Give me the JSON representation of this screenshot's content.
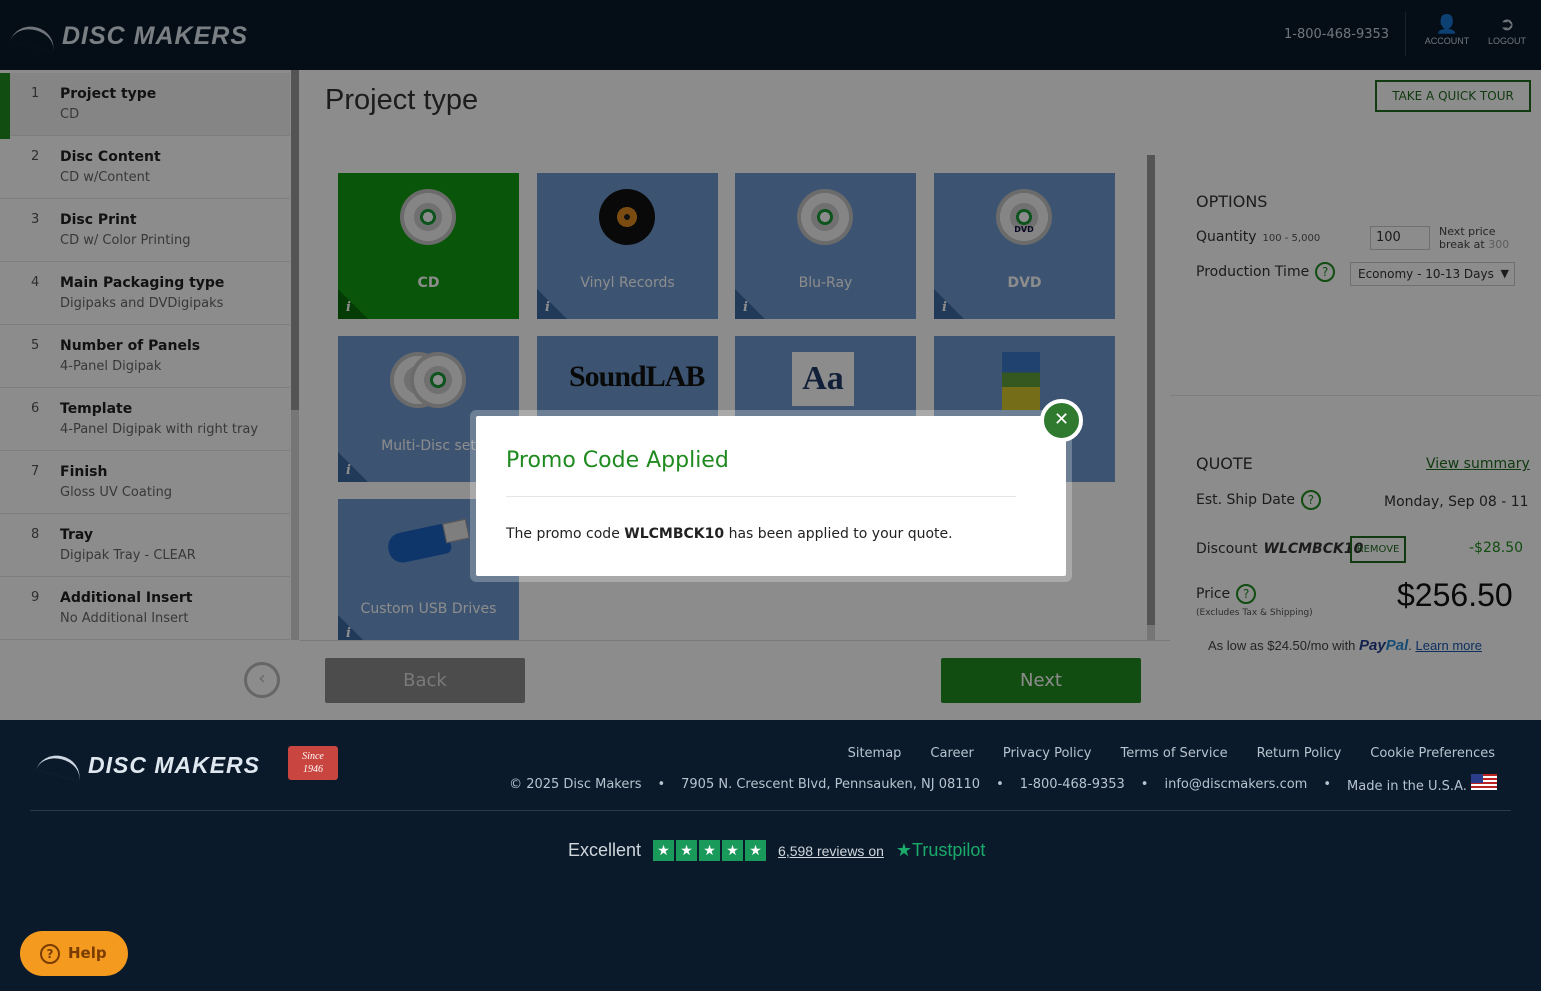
{
  "header": {
    "logo_text": "DISC MAKERS",
    "phone": "1-800-468-9353",
    "account_label": "ACCOUNT",
    "logout_label": "LOGOUT"
  },
  "sidebar": {
    "steps": [
      {
        "num": "1",
        "title": "Project type",
        "value": "CD"
      },
      {
        "num": "2",
        "title": "Disc Content",
        "value": "CD w/Content"
      },
      {
        "num": "3",
        "title": "Disc Print",
        "value": "CD w/ Color Printing"
      },
      {
        "num": "4",
        "title": "Main Packaging type",
        "value": "Digipaks and DVDigipaks"
      },
      {
        "num": "5",
        "title": "Number of Panels",
        "value": "4-Panel Digipak"
      },
      {
        "num": "6",
        "title": "Template",
        "value": "4-Panel Digipak with right tray"
      },
      {
        "num": "7",
        "title": "Finish",
        "value": "Gloss UV Coating"
      },
      {
        "num": "8",
        "title": "Tray",
        "value": "Digipak Tray - CLEAR"
      },
      {
        "num": "9",
        "title": "Additional Insert",
        "value": "No Additional Insert"
      }
    ]
  },
  "main": {
    "title": "Project type",
    "tiles": [
      {
        "label": "CD",
        "selected": true
      },
      {
        "label": "Vinyl Records"
      },
      {
        "label": "Blu-Ray"
      },
      {
        "label": "DVD"
      },
      {
        "label": "Multi-Disc set"
      },
      {
        "label": "SoundLAB"
      },
      {
        "label": "Aa"
      },
      {
        "label": ""
      },
      {
        "label": "Custom USB Drives"
      }
    ],
    "dvd_logo": "DVD",
    "back_label": "Back",
    "next_label": "Next"
  },
  "right": {
    "tour_label": "TAKE A QUICK TOUR",
    "options_title": "OPTIONS",
    "quantity_label": "Quantity",
    "quantity_range": "100 - 5,000",
    "quantity_value": "100",
    "next_price_line1": "Next price",
    "next_price_line2": "break at",
    "next_price_break": "300",
    "production_label": "Production Time",
    "production_value": "Economy - 10-13 Days",
    "quote_title": "QUOTE",
    "view_summary": "View summary",
    "ship_label": "Est. Ship Date",
    "ship_value": "Monday, Sep 08 - 11",
    "discount_label": "Discount",
    "discount_code": "WLCMBCK10",
    "remove_label": "REMOVE",
    "discount_value": "-$28.50",
    "price_label": "Price",
    "price_note": "(Excludes Tax & Shipping)",
    "price_value": "$256.50",
    "paypal_text": "As low as $24.50/mo with",
    "paypal_brand_a": "Pay",
    "paypal_brand_b": "Pal",
    "learn_more": "Learn more"
  },
  "modal": {
    "title": "Promo Code Applied",
    "text_before": "The promo code ",
    "code": "WLCMBCK10",
    "text_after": " has been applied to your quote."
  },
  "footer": {
    "logo_text": "DISC MAKERS",
    "since_line1": "Since",
    "since_line2": "1946",
    "links": [
      "Sitemap",
      "Career",
      "Privacy Policy",
      "Terms of Service",
      "Return Policy",
      "Cookie Preferences"
    ],
    "copyright": "© 2025 Disc Makers",
    "address": "7905 N. Crescent Blvd, Pennsauken, NJ 08110",
    "phone": "1-800-468-9353",
    "email": "info@discmakers.com",
    "made_in": "Made in the U.S.A.",
    "trust_excellent": "Excellent",
    "trust_reviews": "6,598 reviews on",
    "trust_brand": "Trustpilot",
    "help_label": "Help"
  },
  "colors": {
    "brand_green": "#1f8a1f",
    "tile_blue": "#6e9acf",
    "navy": "#0a1a2b",
    "help_orange": "#f39a1f"
  }
}
